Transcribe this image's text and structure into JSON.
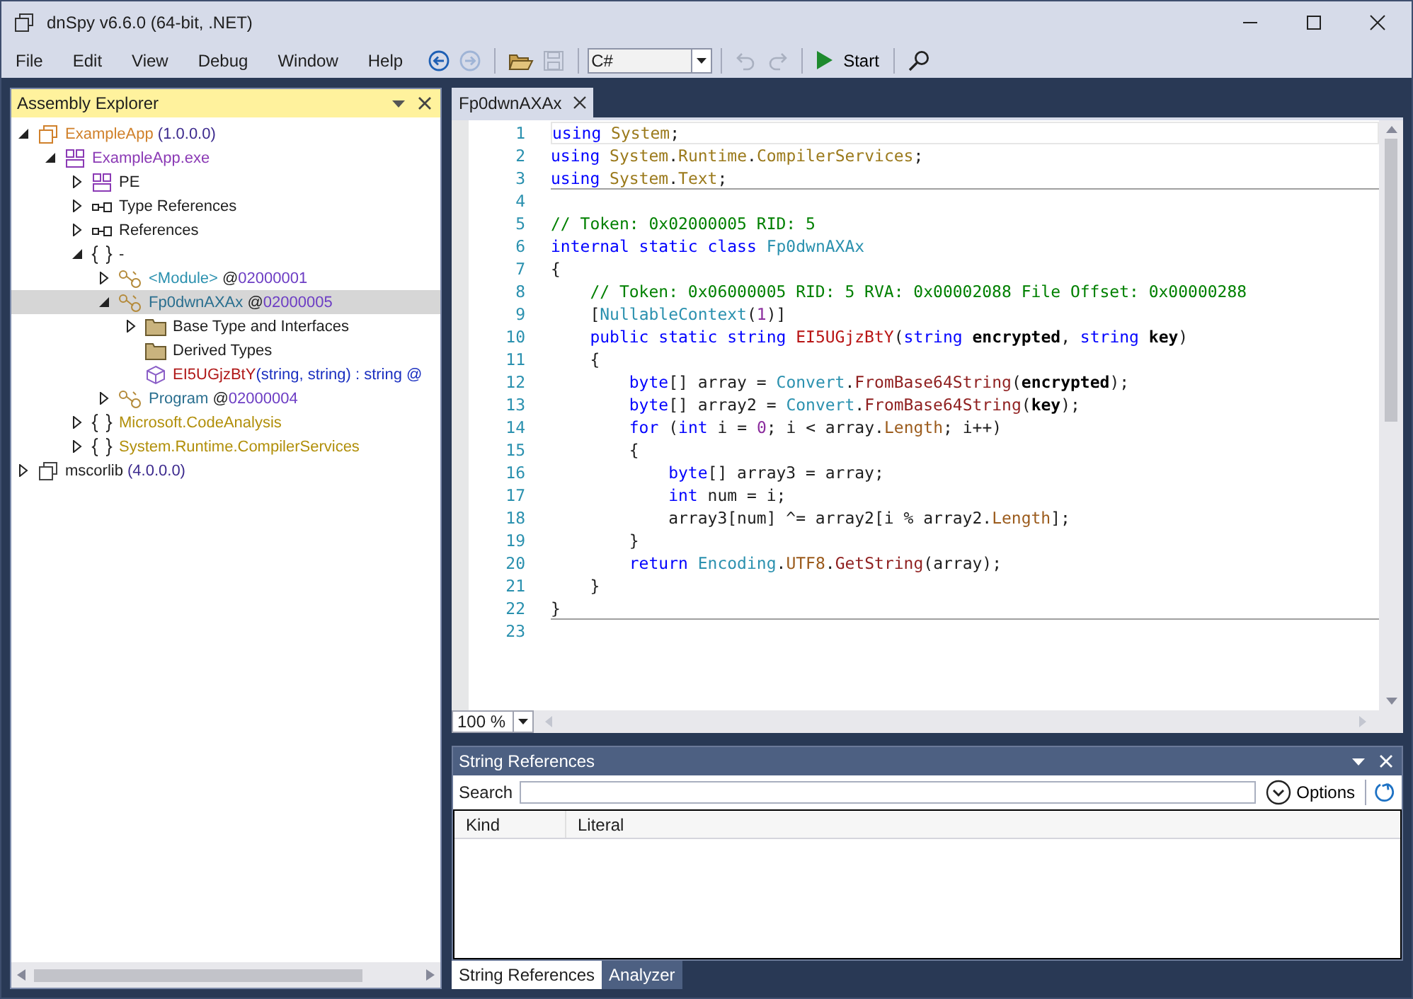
{
  "window": {
    "title": "dnSpy v6.6.0 (64-bit, .NET)"
  },
  "menu": [
    "File",
    "Edit",
    "View",
    "Debug",
    "Window",
    "Help"
  ],
  "toolbar": [
    {
      "kind": "back",
      "disabled": false
    },
    {
      "kind": "forward",
      "disabled": true
    },
    {
      "kind": "sep"
    },
    {
      "kind": "open",
      "disabled": false
    },
    {
      "kind": "save",
      "disabled": true
    },
    {
      "kind": "sep"
    },
    {
      "kind": "combo",
      "value": "C#"
    },
    {
      "kind": "sep"
    },
    {
      "kind": "undo",
      "disabled": true
    },
    {
      "kind": "redo",
      "disabled": true
    },
    {
      "kind": "sep"
    },
    {
      "kind": "start",
      "label": "Start",
      "disabled": false
    },
    {
      "kind": "sep"
    },
    {
      "kind": "search",
      "disabled": false
    }
  ],
  "explorer": {
    "title": "Assembly Explorer",
    "tree": [
      {
        "kind": "assembly",
        "expandable": true,
        "expanded": true,
        "selected": false,
        "parts": [
          {
            "t": "ExampleApp",
            "kind": "asm"
          },
          {
            "t": " (1.0.0.0)",
            "kind": "ver"
          }
        ],
        "children": [
          {
            "kind": "module",
            "expandable": true,
            "expanded": true,
            "selected": false,
            "parts": [
              {
                "t": "ExampleApp.exe",
                "kind": "exe"
              }
            ],
            "children": [
              {
                "kind": "module",
                "expandable": true,
                "expanded": false,
                "selected": false,
                "parts": [
                  {
                    "t": "PE",
                    "kind": "plain"
                  }
                ]
              },
              {
                "kind": "refs",
                "expandable": true,
                "expanded": false,
                "selected": false,
                "parts": [
                  {
                    "t": "Type References",
                    "kind": "plain"
                  }
                ]
              },
              {
                "kind": "refs",
                "expandable": true,
                "expanded": false,
                "selected": false,
                "parts": [
                  {
                    "t": "References",
                    "kind": "plain"
                  }
                ]
              },
              {
                "kind": "namespace",
                "expandable": true,
                "expanded": true,
                "selected": false,
                "parts": [
                  {
                    "t": "-",
                    "kind": "plain"
                  }
                ],
                "children": [
                  {
                    "kind": "class",
                    "expandable": true,
                    "expanded": false,
                    "selected": false,
                    "parts": [
                      {
                        "t": "<Module>",
                        "kind": "module"
                      },
                      {
                        "t": " @",
                        "kind": "plain"
                      },
                      {
                        "t": "02000001",
                        "kind": "token"
                      }
                    ]
                  },
                  {
                    "kind": "class",
                    "expandable": true,
                    "expanded": true,
                    "selected": true,
                    "parts": [
                      {
                        "t": "Fp0dwnAXAx",
                        "kind": "cls"
                      },
                      {
                        "t": " @",
                        "kind": "plain"
                      },
                      {
                        "t": "02000005",
                        "kind": "token"
                      }
                    ],
                    "children": [
                      {
                        "kind": "folder",
                        "expandable": true,
                        "expanded": false,
                        "selected": false,
                        "parts": [
                          {
                            "t": "Base Type and Interfaces",
                            "kind": "plain"
                          }
                        ]
                      },
                      {
                        "kind": "folder",
                        "expandable": false,
                        "selected": false,
                        "parts": [
                          {
                            "t": "Derived Types",
                            "kind": "plain"
                          }
                        ]
                      },
                      {
                        "kind": "method",
                        "expandable": false,
                        "selected": false,
                        "parts": [
                          {
                            "t": "EI5UGjzBtY",
                            "kind": "method"
                          },
                          {
                            "t": "(string, string) : string @",
                            "kind": "sig"
                          }
                        ]
                      }
                    ]
                  },
                  {
                    "kind": "class",
                    "expandable": true,
                    "expanded": false,
                    "selected": false,
                    "parts": [
                      {
                        "t": "Program",
                        "kind": "cls"
                      },
                      {
                        "t": " @",
                        "kind": "plain"
                      },
                      {
                        "t": "02000004",
                        "kind": "token"
                      }
                    ]
                  }
                ]
              },
              {
                "kind": "namespace",
                "expandable": true,
                "expanded": false,
                "selected": false,
                "parts": [
                  {
                    "t": "Microsoft.CodeAnalysis",
                    "kind": "ns"
                  }
                ]
              },
              {
                "kind": "namespace",
                "expandable": true,
                "expanded": false,
                "selected": false,
                "parts": [
                  {
                    "t": "System.Runtime.CompilerServices",
                    "kind": "ns"
                  }
                ]
              }
            ]
          }
        ]
      },
      {
        "kind": "assembly",
        "expandable": true,
        "expanded": false,
        "selected": false,
        "parts": [
          {
            "t": "mscorlib",
            "kind": "plain"
          },
          {
            "t": " (4.0.0.0)",
            "kind": "ver"
          }
        ]
      }
    ]
  },
  "editor": {
    "tab": {
      "label": "Fp0dwnAXAx",
      "selected": true
    },
    "zoom": "100 %",
    "lines": [
      {
        "n": "1",
        "current": true,
        "rule_below": false,
        "tokens": [
          {
            "t": "using ",
            "kind": "kw"
          },
          {
            "t": "System",
            "kind": "ns"
          },
          {
            "t": ";",
            "kind": "p"
          }
        ]
      },
      {
        "n": "2",
        "current": false,
        "rule_below": false,
        "tokens": [
          {
            "t": "using ",
            "kind": "kw"
          },
          {
            "t": "System",
            "kind": "ns"
          },
          {
            "t": ".",
            "kind": "p"
          },
          {
            "t": "Runtime",
            "kind": "ns"
          },
          {
            "t": ".",
            "kind": "p"
          },
          {
            "t": "CompilerServices",
            "kind": "ns"
          },
          {
            "t": ";",
            "kind": "p"
          }
        ]
      },
      {
        "n": "3",
        "current": false,
        "rule_below": true,
        "tokens": [
          {
            "t": "using ",
            "kind": "kw"
          },
          {
            "t": "System",
            "kind": "ns"
          },
          {
            "t": ".",
            "kind": "p"
          },
          {
            "t": "Text",
            "kind": "ns"
          },
          {
            "t": ";",
            "kind": "p"
          }
        ]
      },
      {
        "n": "4",
        "current": false,
        "rule_below": false
      },
      {
        "n": "5",
        "current": false,
        "rule_below": false,
        "tokens": [
          {
            "t": "// Token: 0x02000005 RID: 5",
            "kind": "cm"
          }
        ]
      },
      {
        "n": "6",
        "current": false,
        "rule_below": false,
        "tokens": [
          {
            "t": "internal static class ",
            "kind": "kw"
          },
          {
            "t": "Fp0dwnAXAx",
            "kind": "type"
          }
        ]
      },
      {
        "n": "7",
        "current": false,
        "rule_below": false,
        "tokens": [
          {
            "t": "{",
            "kind": "p"
          }
        ]
      },
      {
        "n": "8",
        "current": false,
        "rule_below": false,
        "tokens": [
          {
            "t": "    // Token: 0x06000005 RID: 5 RVA: 0x00002088 File Offset: 0x00000288",
            "kind": "cm"
          }
        ]
      },
      {
        "n": "9",
        "current": false,
        "rule_below": false,
        "tokens": [
          {
            "t": "    [",
            "kind": "p"
          },
          {
            "t": "NullableContext",
            "kind": "type"
          },
          {
            "t": "(",
            "kind": "p"
          },
          {
            "t": "1",
            "kind": "num"
          },
          {
            "t": ")]",
            "kind": "p"
          }
        ]
      },
      {
        "n": "10",
        "current": false,
        "rule_below": false,
        "tokens": [
          {
            "t": "    public static string ",
            "kind": "kw"
          },
          {
            "t": "EI5UGjzBtY",
            "kind": "def"
          },
          {
            "t": "(",
            "kind": "p"
          },
          {
            "t": "string ",
            "kind": "kw"
          },
          {
            "t": "encrypted",
            "kind": "param"
          },
          {
            "t": ", ",
            "kind": "p"
          },
          {
            "t": "string ",
            "kind": "kw"
          },
          {
            "t": "key",
            "kind": "param"
          },
          {
            "t": ")",
            "kind": "p"
          }
        ]
      },
      {
        "n": "11",
        "current": false,
        "rule_below": false,
        "tokens": [
          {
            "t": "    {",
            "kind": "p"
          }
        ]
      },
      {
        "n": "12",
        "current": false,
        "rule_below": false,
        "tokens": [
          {
            "t": "        byte",
            "kind": "kw"
          },
          {
            "t": "[] array = ",
            "kind": "p"
          },
          {
            "t": "Convert",
            "kind": "type"
          },
          {
            "t": ".",
            "kind": "p"
          },
          {
            "t": "FromBase64String",
            "kind": "call"
          },
          {
            "t": "(",
            "kind": "p"
          },
          {
            "t": "encrypted",
            "kind": "param"
          },
          {
            "t": ");",
            "kind": "p"
          }
        ]
      },
      {
        "n": "13",
        "current": false,
        "rule_below": false,
        "tokens": [
          {
            "t": "        byte",
            "kind": "kw"
          },
          {
            "t": "[] array2 = ",
            "kind": "p"
          },
          {
            "t": "Convert",
            "kind": "type"
          },
          {
            "t": ".",
            "kind": "p"
          },
          {
            "t": "FromBase64String",
            "kind": "call"
          },
          {
            "t": "(",
            "kind": "p"
          },
          {
            "t": "key",
            "kind": "param"
          },
          {
            "t": ");",
            "kind": "p"
          }
        ]
      },
      {
        "n": "14",
        "current": false,
        "rule_below": false,
        "tokens": [
          {
            "t": "        for",
            "kind": "kw"
          },
          {
            "t": " (",
            "kind": "p"
          },
          {
            "t": "int",
            "kind": "kw"
          },
          {
            "t": " i = ",
            "kind": "p"
          },
          {
            "t": "0",
            "kind": "num"
          },
          {
            "t": "; i < array.",
            "kind": "p"
          },
          {
            "t": "Length",
            "kind": "prop"
          },
          {
            "t": "; i++)",
            "kind": "p"
          }
        ]
      },
      {
        "n": "15",
        "current": false,
        "rule_below": false,
        "tokens": [
          {
            "t": "        {",
            "kind": "p"
          }
        ]
      },
      {
        "n": "16",
        "current": false,
        "rule_below": false,
        "tokens": [
          {
            "t": "            byte",
            "kind": "kw"
          },
          {
            "t": "[] array3 = array;",
            "kind": "p"
          }
        ]
      },
      {
        "n": "17",
        "current": false,
        "rule_below": false,
        "tokens": [
          {
            "t": "            int",
            "kind": "kw"
          },
          {
            "t": " num = i;",
            "kind": "p"
          }
        ]
      },
      {
        "n": "18",
        "current": false,
        "rule_below": false,
        "tokens": [
          {
            "t": "            array3[num] ^= array2[i % array2.",
            "kind": "p"
          },
          {
            "t": "Length",
            "kind": "prop"
          },
          {
            "t": "];",
            "kind": "p"
          }
        ]
      },
      {
        "n": "19",
        "current": false,
        "rule_below": false,
        "tokens": [
          {
            "t": "        }",
            "kind": "p"
          }
        ]
      },
      {
        "n": "20",
        "current": false,
        "rule_below": false,
        "tokens": [
          {
            "t": "        return ",
            "kind": "kw"
          },
          {
            "t": "Encoding",
            "kind": "type"
          },
          {
            "t": ".",
            "kind": "p"
          },
          {
            "t": "UTF8",
            "kind": "prop"
          },
          {
            "t": ".",
            "kind": "p"
          },
          {
            "t": "GetString",
            "kind": "call"
          },
          {
            "t": "(array);",
            "kind": "p"
          }
        ]
      },
      {
        "n": "21",
        "current": false,
        "rule_below": false,
        "tokens": [
          {
            "t": "    }",
            "kind": "p"
          }
        ]
      },
      {
        "n": "22",
        "current": false,
        "rule_below": true,
        "tokens": [
          {
            "t": "}",
            "kind": "p"
          }
        ]
      },
      {
        "n": "23",
        "current": false,
        "rule_below": false
      }
    ]
  },
  "string_references": {
    "title": "String References",
    "search_label": "Search",
    "options": "Options",
    "columns": [
      "Kind",
      "Literal"
    ]
  },
  "bottom_tabs": [
    {
      "label": "String References",
      "selected": true
    },
    {
      "label": "Analyzer",
      "selected": false
    }
  ]
}
